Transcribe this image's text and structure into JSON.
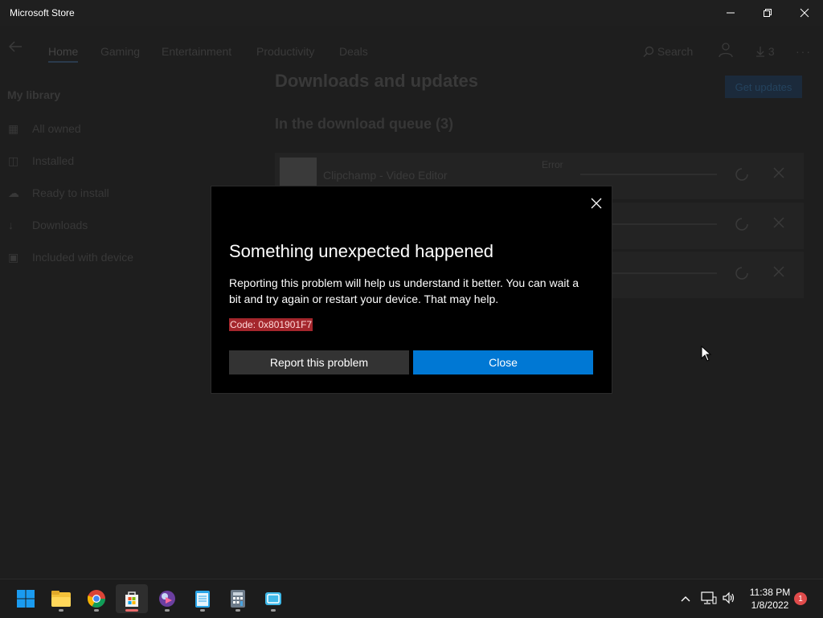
{
  "window": {
    "title": "Microsoft Store",
    "controls": {
      "minimize_icon": "minimize-icon",
      "restore_icon": "restore-icon",
      "close_icon": "close-icon"
    }
  },
  "nav": {
    "tabs": [
      {
        "label": "Home"
      },
      {
        "label": "Gaming"
      },
      {
        "label": "Entertainment"
      },
      {
        "label": "Productivity"
      },
      {
        "label": "Deals"
      }
    ],
    "search_label": "Search",
    "downloads_count": "3"
  },
  "sidebar": {
    "title": "My library",
    "items": [
      {
        "label": "All owned",
        "icon": "grid-icon"
      },
      {
        "label": "Installed",
        "icon": "installed-icon"
      },
      {
        "label": "Ready to install",
        "icon": "cloud-icon"
      },
      {
        "label": "Downloads",
        "icon": "download-icon"
      },
      {
        "label": "Included with device",
        "icon": "device-icon"
      }
    ]
  },
  "main": {
    "title": "Downloads and updates",
    "get_updates_label": "Get updates",
    "queue_title": "In the download queue (3)",
    "queue": [
      {
        "name": "Clipchamp - Video Editor",
        "status": "Error"
      },
      {
        "name": "",
        "status": ""
      },
      {
        "name": "",
        "status": ""
      }
    ]
  },
  "dialog": {
    "title": "Something unexpected happened",
    "message": "Reporting this problem will help us understand it better. You can wait a bit and try again or restart your device. That may help.",
    "code": "Code: 0x801901F7",
    "report_label": "Report this problem",
    "close_label": "Close"
  },
  "taskbar": {
    "apps": [
      "start-icon",
      "file-explorer-icon",
      "chrome-icon",
      "microsoft-store-icon",
      "media-player-icon",
      "notepad-icon",
      "calculator-icon",
      "snip-icon"
    ],
    "active_app": "microsoft-store-icon",
    "time": "11:38 PM",
    "date": "1/8/2022",
    "notification_count": "1"
  },
  "colors": {
    "accent": "#0078d4",
    "error_code_bg": "#a4262c",
    "dialog_bg": "#000000"
  }
}
